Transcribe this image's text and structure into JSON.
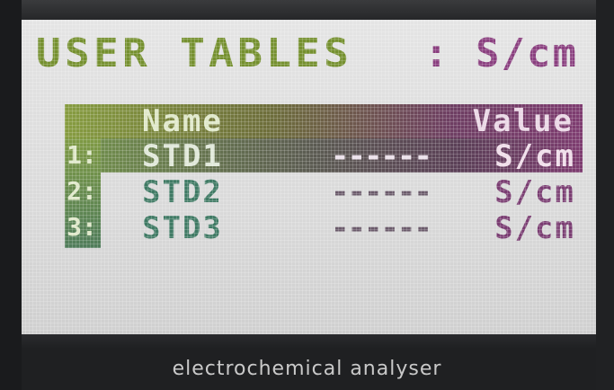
{
  "screen": {
    "title": "USER TABLES",
    "unit_label": ": S/cm",
    "columns": {
      "name": "Name",
      "value": "Value"
    },
    "rows": [
      {
        "index": "1:",
        "name": "STD1",
        "value": "------",
        "unit": "S/cm",
        "selected": true
      },
      {
        "index": "2:",
        "name": "STD2",
        "value": "------",
        "unit": "S/cm",
        "selected": false
      },
      {
        "index": "3:",
        "name": "STD3",
        "value": "------",
        "unit": "S/cm",
        "selected": false
      }
    ]
  },
  "device": {
    "label": "electrochemical analyser"
  },
  "colors": {
    "accent_green": "#75902f",
    "accent_purple": "#8a3f7f"
  }
}
